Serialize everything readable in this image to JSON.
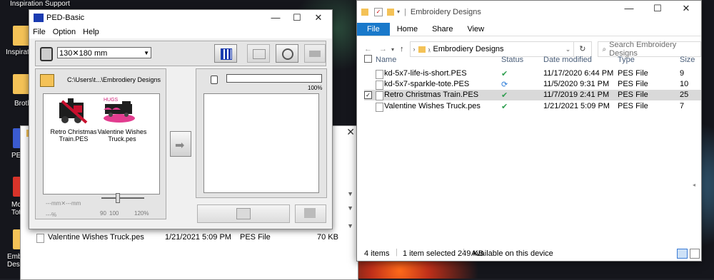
{
  "desktop": {
    "icons": [
      {
        "label": "Inspiration\nSupport"
      },
      {
        "label": "Inspiratio"
      },
      {
        "label": "Broth"
      },
      {
        "label": "PED"
      },
      {
        "label": "Mc\nTota"
      },
      {
        "label": "Embroide\nDesig"
      }
    ]
  },
  "back_window": {
    "row": {
      "name": "Valentine Wishes Truck.pes",
      "date": "1/21/2021 5:09 PM",
      "type": "PES File",
      "size": "70 KB"
    }
  },
  "ped": {
    "title": "PED-Basic",
    "menu": [
      "File",
      "Option",
      "Help"
    ],
    "hoop_size": "130✕180 mm",
    "path": "C:\\Users\\t...\\Embrodiery Designs",
    "designs": [
      {
        "name": "Retro Christmas\nTrain.PES"
      },
      {
        "name": "Valentine Wishes\nTruck.pes"
      }
    ],
    "size_text": "---mm✕---mm",
    "zoom_text": "---%",
    "zoom_scale": [
      "90",
      "100",
      "120%"
    ],
    "progress": "100%",
    "progress_value": 1.0
  },
  "explorer": {
    "title": "Embroidery Designs",
    "ribbon_tabs": [
      "File",
      "Home",
      "Share",
      "View"
    ],
    "breadcrumb": "Embrodiery Designs",
    "search_placeholder": "Search Embroidery Designs",
    "columns": {
      "name": "Name",
      "status": "Status",
      "date": "Date modified",
      "type": "Type",
      "size": "Size"
    },
    "files": [
      {
        "name": "kd-5x7-life-is-short.PES",
        "status": "ok",
        "date": "11/17/2020 6:44 PM",
        "type": "PES File",
        "size": "9"
      },
      {
        "name": "kd-5x7-sparkle-tote.PES",
        "status": "sync",
        "date": "11/5/2020 9:31 PM",
        "type": "PES File",
        "size": "10"
      },
      {
        "name": "Retro Christmas Train.PES",
        "status": "ok",
        "date": "11/7/2019 2:41 PM",
        "type": "PES File",
        "size": "25",
        "selected": true
      },
      {
        "name": "Valentine Wishes Truck.pes",
        "status": "ok",
        "date": "1/21/2021 5:09 PM",
        "type": "PES File",
        "size": "7"
      }
    ],
    "status": {
      "items": "4 items",
      "selected": "1 item selected  249 KB",
      "availability": "Available on this device"
    },
    "colors": {
      "file_tab": "#1979ca",
      "ok": "#2e9e4f",
      "sync": "#2a7bd8"
    }
  }
}
